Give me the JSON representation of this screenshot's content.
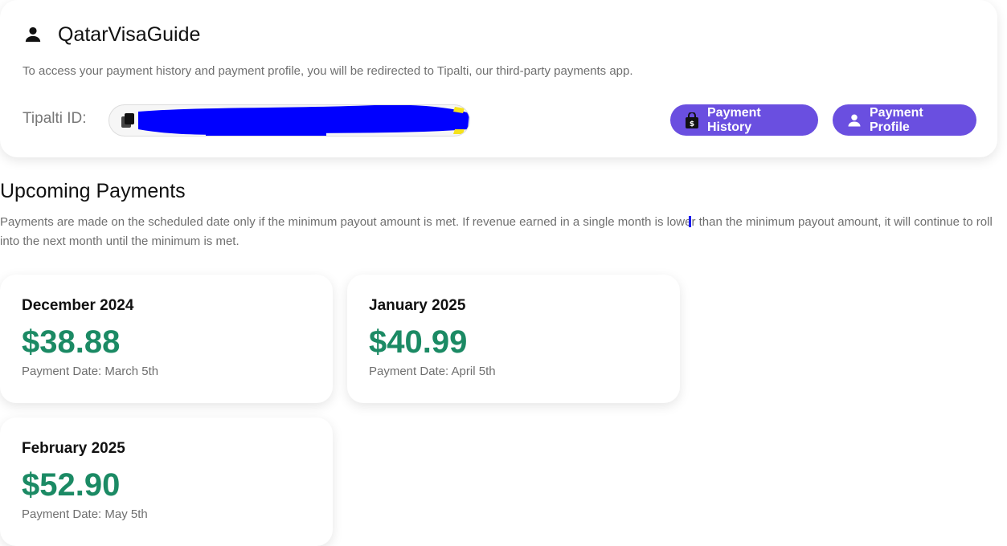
{
  "account": {
    "name": "QatarVisaGuide",
    "redirect_note": "To access your payment history and payment profile, you will be redirected to Tipalti, our third-party payments app.",
    "id_label": "Tipalti ID:",
    "id_value": "",
    "payment_history_label": "Payment History",
    "payment_profile_label": "Payment Profile"
  },
  "upcoming": {
    "title": "Upcoming Payments",
    "description": "Payments are made on the scheduled date only if the minimum payout amount is met. If revenue earned in a single month is lower than the minimum payout amount, it will continue to roll into the next month until the minimum is met.",
    "payments": [
      {
        "month": "December 2024",
        "amount": "$38.88",
        "date": "Payment Date: March 5th"
      },
      {
        "month": "January 2025",
        "amount": "$40.99",
        "date": "Payment Date: April 5th"
      },
      {
        "month": "February 2025",
        "amount": "$52.90",
        "date": "Payment Date: May 5th"
      }
    ]
  },
  "colors": {
    "accent": "#6a4fe0",
    "amount": "#1b8a64",
    "muted_text": "#6f6f6f"
  },
  "icons": [
    "person-icon",
    "copy-icon",
    "shopping-bag-icon",
    "person-icon"
  ]
}
